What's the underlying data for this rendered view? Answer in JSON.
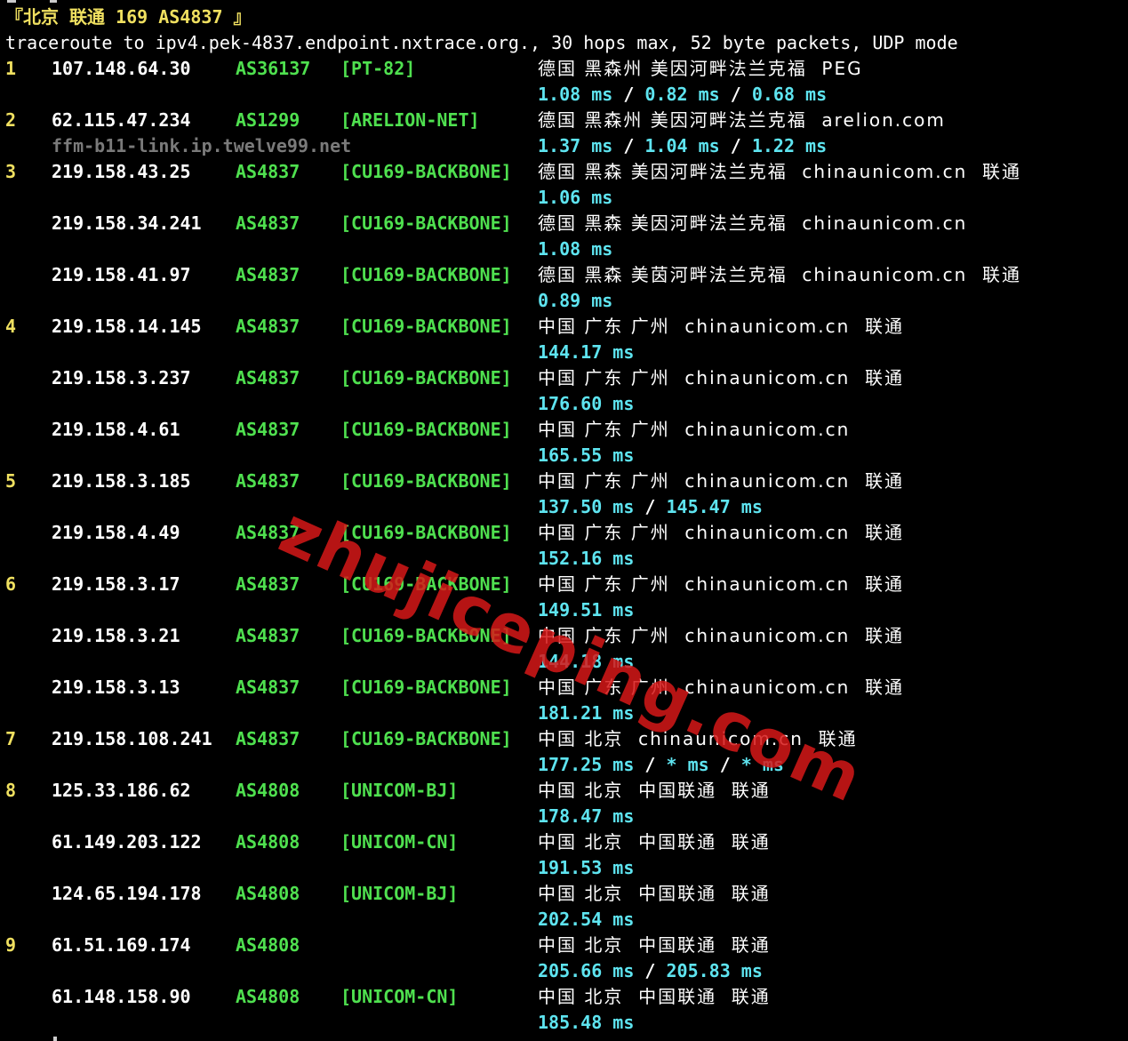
{
  "header": {
    "title": "『北京 联通 169 AS4837 』",
    "command": "traceroute to ipv4.pek-4837.endpoint.nxtrace.org., 30 hops max, 52 byte packets, UDP mode"
  },
  "rows": [
    {
      "hop": "1",
      "ip": "107.148.64.30",
      "asn": "AS36137",
      "net": "[PT-82]",
      "geo": "德国 黑森州 美因河畔法兰克福  PEG",
      "lat": [
        "1.08 ms",
        "0.82 ms",
        "0.68 ms"
      ]
    },
    {
      "hop": "2",
      "ip": "62.115.47.234",
      "asn": "AS1299",
      "net": "[ARELION-NET]",
      "geo": "德国 黑森州 美因河畔法兰克福  arelion.com",
      "rdns": "ffm-b11-link.ip.twelve99.net",
      "lat": [
        "1.37 ms",
        "1.04 ms",
        "1.22 ms"
      ]
    },
    {
      "hop": "3",
      "ip": "219.158.43.25",
      "asn": "AS4837",
      "net": "[CU169-BACKBONE]",
      "geo": "德国 黑森 美因河畔法兰克福  chinaunicom.cn  联通",
      "lat": [
        "1.06 ms"
      ]
    },
    {
      "hop": "",
      "ip": "219.158.34.241",
      "asn": "AS4837",
      "net": "[CU169-BACKBONE]",
      "geo": "德国 黑森 美因河畔法兰克福  chinaunicom.cn",
      "lat": [
        "1.08 ms"
      ]
    },
    {
      "hop": "",
      "ip": "219.158.41.97",
      "asn": "AS4837",
      "net": "[CU169-BACKBONE]",
      "geo": "德国 黑森 美茵河畔法兰克福  chinaunicom.cn  联通",
      "lat": [
        "0.89 ms"
      ]
    },
    {
      "hop": "4",
      "ip": "219.158.14.145",
      "asn": "AS4837",
      "net": "[CU169-BACKBONE]",
      "geo": "中国 广东 广州  chinaunicom.cn  联通",
      "lat": [
        "144.17 ms"
      ]
    },
    {
      "hop": "",
      "ip": "219.158.3.237",
      "asn": "AS4837",
      "net": "[CU169-BACKBONE]",
      "geo": "中国 广东 广州  chinaunicom.cn  联通",
      "lat": [
        "176.60 ms"
      ]
    },
    {
      "hop": "",
      "ip": "219.158.4.61",
      "asn": "AS4837",
      "net": "[CU169-BACKBONE]",
      "geo": "中国 广东 广州  chinaunicom.cn",
      "lat": [
        "165.55 ms"
      ]
    },
    {
      "hop": "5",
      "ip": "219.158.3.185",
      "asn": "AS4837",
      "net": "[CU169-BACKBONE]",
      "geo": "中国 广东 广州  chinaunicom.cn  联通",
      "lat": [
        "137.50 ms",
        "145.47 ms"
      ]
    },
    {
      "hop": "",
      "ip": "219.158.4.49",
      "asn": "AS4837",
      "net": "[CU169-BACKBONE]",
      "geo": "中国 广东 广州  chinaunicom.cn  联通",
      "lat": [
        "152.16 ms"
      ]
    },
    {
      "hop": "6",
      "ip": "219.158.3.17",
      "asn": "AS4837",
      "net": "[CU169-BACKBONE]",
      "geo": "中国 广东 广州  chinaunicom.cn  联通",
      "lat": [
        "149.51 ms"
      ]
    },
    {
      "hop": "",
      "ip": "219.158.3.21",
      "asn": "AS4837",
      "net": "[CU169-BACKBONE]",
      "geo": "中国 广东 广州  chinaunicom.cn  联通",
      "lat": [
        "144.18 ms"
      ]
    },
    {
      "hop": "",
      "ip": "219.158.3.13",
      "asn": "AS4837",
      "net": "[CU169-BACKBONE]",
      "geo": "中国 广东 广州  chinaunicom.cn  联通",
      "lat": [
        "181.21 ms"
      ]
    },
    {
      "hop": "7",
      "ip": "219.158.108.241",
      "asn": "AS4837",
      "net": "[CU169-BACKBONE]",
      "geo": "中国 北京  chinaunicom.cn  联通",
      "lat": [
        "177.25 ms",
        "* ms",
        "* ms"
      ]
    },
    {
      "hop": "8",
      "ip": "125.33.186.62",
      "asn": "AS4808",
      "net": "[UNICOM-BJ]",
      "geo": "中国 北京  中国联通  联通",
      "lat": [
        "178.47 ms"
      ]
    },
    {
      "hop": "",
      "ip": "61.149.203.122",
      "asn": "AS4808",
      "net": "[UNICOM-CN]",
      "geo": "中国 北京  中国联通  联通",
      "lat": [
        "191.53 ms"
      ]
    },
    {
      "hop": "",
      "ip": "124.65.194.178",
      "asn": "AS4808",
      "net": "[UNICOM-BJ]",
      "geo": "中国 北京  中国联通  联通",
      "lat": [
        "202.54 ms"
      ]
    },
    {
      "hop": "9",
      "ip": "61.51.169.174",
      "asn": "AS4808",
      "net": "",
      "geo": "中国 北京  中国联通  联通",
      "lat": [
        "205.66 ms",
        "205.83 ms"
      ]
    },
    {
      "hop": "",
      "ip": "61.148.158.90",
      "asn": "AS4808",
      "net": "[UNICOM-CN]",
      "geo": "中国 北京  中国联通  联通",
      "lat": [
        "185.48 ms"
      ]
    }
  ],
  "latency_separator": " / ",
  "watermark": "zhujiceping.com",
  "colors": {
    "background": "#000000",
    "hop": "#f0e060",
    "ip": "#ffffff",
    "asn": "#4fe04f",
    "latency": "#5ee4f0",
    "watermark": "#d61818"
  }
}
